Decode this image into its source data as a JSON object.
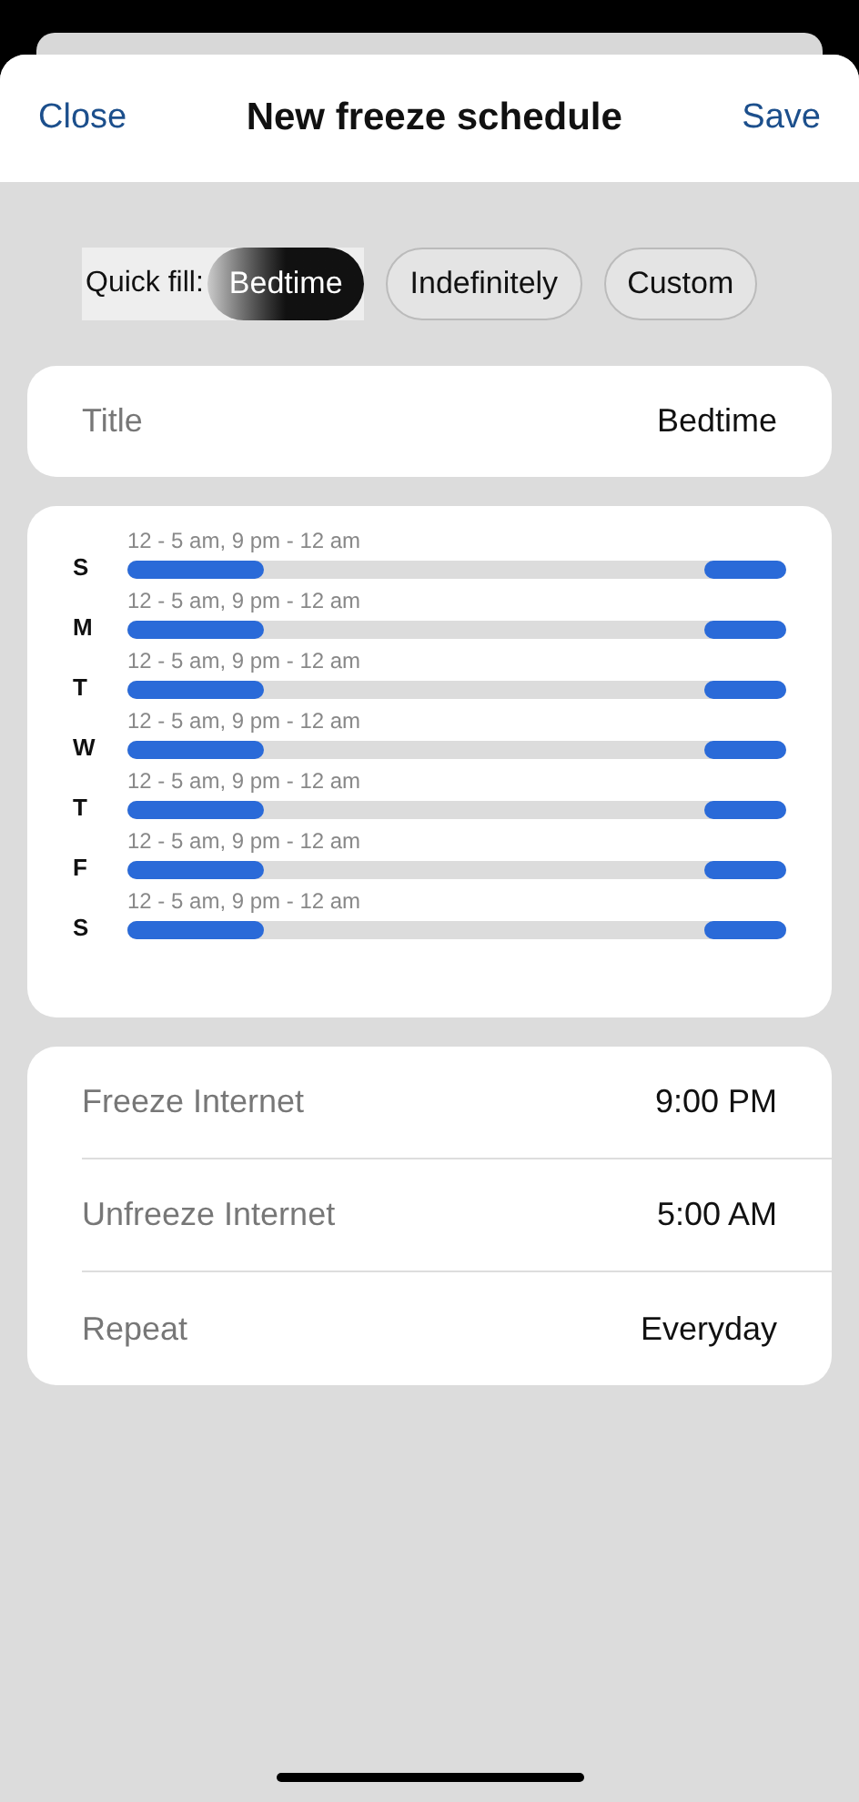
{
  "header": {
    "close": "Close",
    "title": "New freeze schedule",
    "save": "Save"
  },
  "quick_fill": {
    "label": "Quick fill:",
    "options": [
      {
        "label": "Bedtime",
        "selected": true
      },
      {
        "label": "Indefinitely",
        "selected": false
      },
      {
        "label": "Custom",
        "selected": false
      }
    ]
  },
  "title_field": {
    "label": "Title",
    "value": "Bedtime"
  },
  "days": [
    {
      "day": "S",
      "range": "12 - 5 am, 9 pm - 12 am",
      "segments": [
        {
          "kind": "start",
          "level": 0.208
        },
        {
          "kind": "end",
          "level": 0.125
        }
      ]
    },
    {
      "day": "M",
      "range": "12 - 5 am, 9 pm - 12 am",
      "segments": [
        {
          "kind": "start",
          "level": 0.208
        },
        {
          "kind": "end",
          "level": 0.125
        }
      ]
    },
    {
      "day": "T",
      "range": "12 - 5 am, 9 pm - 12 am",
      "segments": [
        {
          "kind": "start",
          "level": 0.208
        },
        {
          "kind": "end",
          "level": 0.125
        }
      ]
    },
    {
      "day": "W",
      "range": "12 - 5 am, 9 pm - 12 am",
      "segments": [
        {
          "kind": "start",
          "level": 0.208
        },
        {
          "kind": "end",
          "level": 0.125
        }
      ]
    },
    {
      "day": "T",
      "range": "12 - 5 am, 9 pm - 12 am",
      "segments": [
        {
          "kind": "start",
          "level": 0.208
        },
        {
          "kind": "end",
          "level": 0.125
        }
      ]
    },
    {
      "day": "F",
      "range": "12 - 5 am, 9 pm - 12 am",
      "segments": [
        {
          "kind": "start",
          "level": 0.208
        },
        {
          "kind": "end",
          "level": 0.125
        }
      ]
    },
    {
      "day": "S",
      "range": "12 - 5 am, 9 pm - 12 am",
      "segments": [
        {
          "kind": "start",
          "level": 0.208
        },
        {
          "kind": "end",
          "level": 0.125
        }
      ]
    }
  ],
  "settings": [
    {
      "label": "Freeze Internet",
      "value": "9:00 PM"
    },
    {
      "label": "Unfreeze Internet",
      "value": "5:00 AM"
    },
    {
      "label": "Repeat",
      "value": "Everyday"
    }
  ]
}
